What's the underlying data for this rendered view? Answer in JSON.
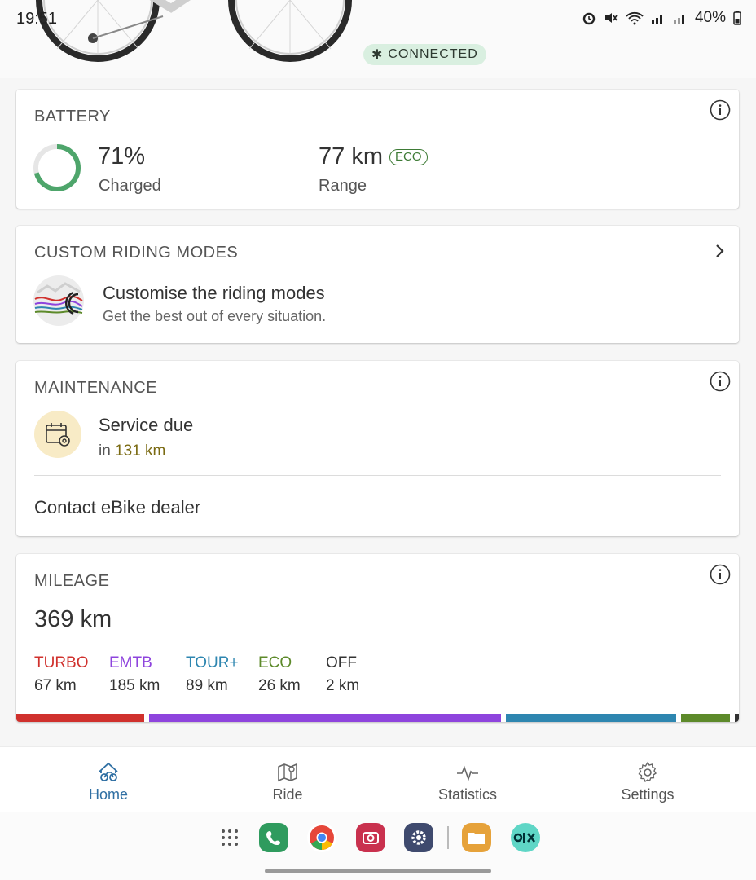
{
  "status_bar": {
    "time": "19:51",
    "battery_pct": "40%"
  },
  "connection": {
    "label": "CONNECTED"
  },
  "battery": {
    "title": "BATTERY",
    "percent": "71%",
    "percent_label": "Charged",
    "charge_fraction": 0.71,
    "range": "77 km",
    "range_mode": "ECO",
    "range_label": "Range"
  },
  "riding_modes": {
    "title": "CUSTOM RIDING MODES",
    "heading": "Customise the riding modes",
    "subheading": "Get the best out of every situation."
  },
  "maintenance": {
    "title": "MAINTENANCE",
    "service_label": "Service due",
    "in_prefix": "in",
    "in_value": "131 km",
    "dealer_link": "Contact eBike dealer"
  },
  "mileage": {
    "title": "MILEAGE",
    "total": "369 km",
    "modes": [
      {
        "name": "TURBO",
        "value": "67 km",
        "km": 67,
        "color": "#d0312d"
      },
      {
        "name": "EMTB",
        "value": "185 km",
        "km": 185,
        "color": "#8e44dd"
      },
      {
        "name": "TOUR+",
        "value": "89 km",
        "km": 89,
        "color": "#2e86b0"
      },
      {
        "name": "ECO",
        "value": "26 km",
        "km": 26,
        "color": "#5d8a2a"
      },
      {
        "name": "OFF",
        "value": "2 km",
        "km": 2,
        "color": "#333333"
      }
    ]
  },
  "nav": {
    "items": [
      {
        "label": "Home",
        "icon": "bike-home-icon",
        "active": true
      },
      {
        "label": "Ride",
        "icon": "map-icon"
      },
      {
        "label": "Statistics",
        "icon": "activity-icon"
      },
      {
        "label": "Settings",
        "icon": "gear-icon"
      }
    ]
  },
  "colors": {
    "accent": "#2f6fa3",
    "battery_ring": "#4ea56b",
    "maintenance_highlight": "#7a6a12",
    "maintenance_icon_bg": "#f8ebc6"
  },
  "dock": {
    "apps": [
      "app-drawer-icon",
      "phone-icon",
      "chrome-icon",
      "camera-icon",
      "settings-icon",
      "files-icon",
      "olx-icon"
    ]
  }
}
